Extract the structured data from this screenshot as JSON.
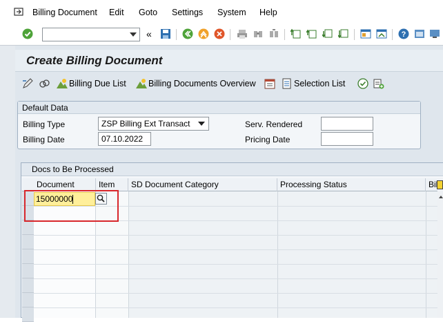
{
  "menu": {
    "items": [
      "Billing Document",
      "Edit",
      "Goto",
      "Settings",
      "System",
      "Help"
    ]
  },
  "toolbar": {
    "command_value": "",
    "back_label": "«"
  },
  "page": {
    "title": "Create Billing Document"
  },
  "app_toolbar": {
    "billing_due_list": "Billing Due List",
    "billing_docs_overview": "Billing Documents Overview",
    "selection_list": "Selection List"
  },
  "default_data": {
    "header": "Default Data",
    "billing_type_label": "Billing Type",
    "billing_type_value": "ZSP Billing Ext Transact",
    "billing_date_label": "Billing Date",
    "billing_date_value": "07.10.2022",
    "serv_rendered_label": "Serv. Rendered",
    "serv_rendered_value": "",
    "pricing_date_label": "Pricing Date",
    "pricing_date_value": ""
  },
  "docs": {
    "header": "Docs to Be Processed",
    "columns": [
      "Document",
      "Item",
      "SD Document Category",
      "Processing Status",
      "Billi"
    ],
    "rows": [
      {
        "document": "15000000",
        "item": "",
        "category": "",
        "status": ""
      }
    ]
  },
  "colors": {
    "highlight": "#d8262b",
    "input_active": "#ffef9a",
    "background": "#dfe6ed"
  }
}
